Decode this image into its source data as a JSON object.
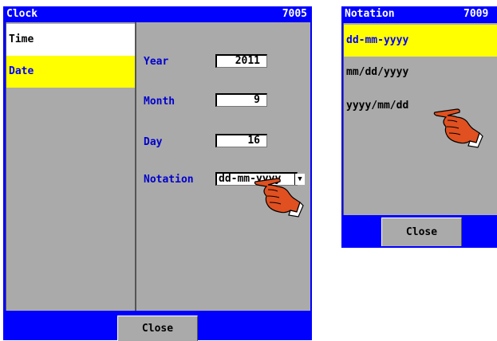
{
  "clock": {
    "title": "Clock",
    "code": "7005",
    "sidebar": [
      {
        "label": "Time"
      },
      {
        "label": "Date"
      }
    ],
    "fields": {
      "year": {
        "label": "Year",
        "value": "2011"
      },
      "month": {
        "label": "Month",
        "value": "9"
      },
      "day": {
        "label": "Day",
        "value": "16"
      },
      "notation": {
        "label": "Notation",
        "value": "dd-mm-yyyy"
      }
    },
    "close_label": "Close"
  },
  "notation_window": {
    "title": "Notation",
    "code": "7009",
    "options": [
      {
        "label": "dd-mm-yyyy"
      },
      {
        "label": "mm/dd/yyyy"
      },
      {
        "label": "yyyy/mm/dd"
      }
    ],
    "close_label": "Close"
  },
  "colors": {
    "window_blue": "#0000ff",
    "panel_gray": "#aaaaaa",
    "highlight_yellow": "#ffff00",
    "label_blue": "#0000cc"
  },
  "icons": [
    "hand-pointer-icon",
    "dropdown-arrow-icon"
  ]
}
